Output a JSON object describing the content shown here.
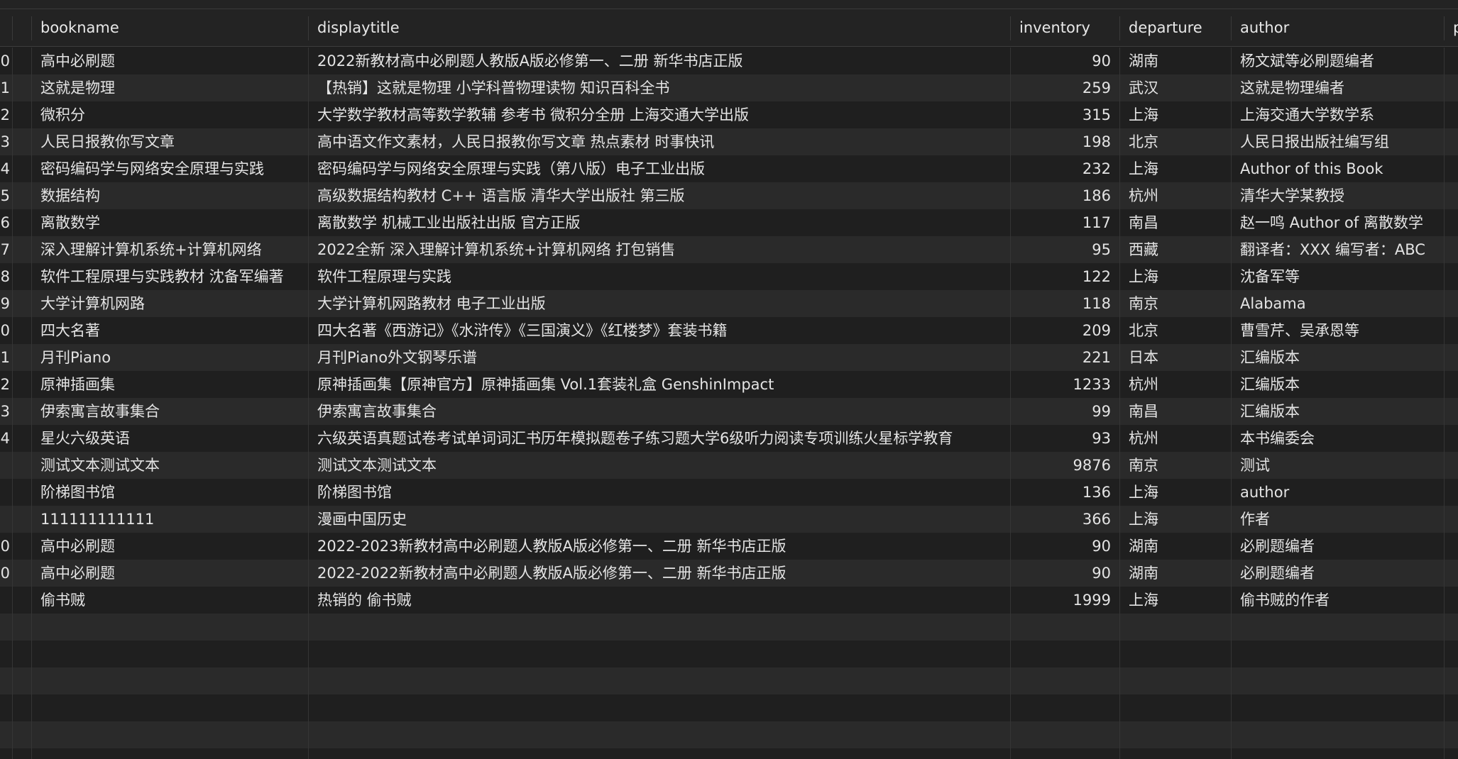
{
  "table": {
    "columns": [
      {
        "key": "index",
        "label": ""
      },
      {
        "key": "bookname",
        "label": "bookname"
      },
      {
        "key": "displaytitle",
        "label": "displaytitle"
      },
      {
        "key": "inventory",
        "label": "inventory"
      },
      {
        "key": "departure",
        "label": "departure"
      },
      {
        "key": "author",
        "label": "author"
      },
      {
        "key": "extra",
        "label": "p"
      }
    ],
    "rows": [
      {
        "index": "0",
        "bookname": "高中必刷题",
        "displaytitle": "2022新教材高中必刷题人教版A版必修第一、二册 新华书店正版",
        "inventory": "90",
        "departure": "湖南",
        "author": "杨文斌等必刷题编者"
      },
      {
        "index": "1",
        "bookname": "这就是物理",
        "displaytitle": "【热销】这就是物理 小学科普物理读物 知识百科全书",
        "inventory": "259",
        "departure": "武汉",
        "author": "这就是物理编者"
      },
      {
        "index": "2",
        "bookname": "微积分",
        "displaytitle": "大学数学教材高等数学教辅 参考书 微积分全册 上海交通大学出版",
        "inventory": "315",
        "departure": "上海",
        "author": "上海交通大学数学系"
      },
      {
        "index": "3",
        "bookname": "人民日报教你写文章",
        "displaytitle": "高中语文作文素材，人民日报教你写文章 热点素材 时事快讯",
        "inventory": "198",
        "departure": "北京",
        "author": "人民日报出版社编写组"
      },
      {
        "index": "4",
        "bookname": "密码编码学与网络安全原理与实践",
        "displaytitle": "密码编码学与网络安全原理与实践（第八版）电子工业出版",
        "inventory": "232",
        "departure": "上海",
        "author": "Author of this Book"
      },
      {
        "index": "5",
        "bookname": "数据结构",
        "displaytitle": "高级数据结构教材 C++ 语言版 清华大学出版社 第三版",
        "inventory": "186",
        "departure": "杭州",
        "author": "清华大学某教授"
      },
      {
        "index": "6",
        "bookname": "离散数学",
        "displaytitle": "离散数学 机械工业出版社出版 官方正版",
        "inventory": "117",
        "departure": "南昌",
        "author": "赵一鸣 Author of 离散数学"
      },
      {
        "index": "7",
        "bookname": "深入理解计算机系统+计算机网络",
        "displaytitle": "2022全新 深入理解计算机系统+计算机网络 打包销售",
        "inventory": "95",
        "departure": "西藏",
        "author": "翻译者：XXX 编写者：ABC"
      },
      {
        "index": "8",
        "bookname": "软件工程原理与实践教材 沈备军编著",
        "displaytitle": "软件工程原理与实践",
        "inventory": "122",
        "departure": "上海",
        "author": "沈备军等"
      },
      {
        "index": "9",
        "bookname": "大学计算机网路",
        "displaytitle": "大学计算机网路教材 电子工业出版",
        "inventory": "118",
        "departure": "南京",
        "author": "Alabama"
      },
      {
        "index": "0",
        "bookname": "四大名著",
        "displaytitle": "四大名著《西游记》《水浒传》《三国演义》《红楼梦》套装书籍",
        "inventory": "209",
        "departure": "北京",
        "author": "曹雪芹、吴承恩等"
      },
      {
        "index": "1",
        "bookname": "月刊Piano",
        "displaytitle": "月刊Piano外文钢琴乐谱",
        "inventory": "221",
        "departure": "日本",
        "author": "汇编版本"
      },
      {
        "index": "2",
        "bookname": "原神插画集",
        "displaytitle": "原神插画集【原神官方】原神插画集 Vol.1套装礼盒 GenshinImpact",
        "inventory": "1233",
        "departure": "杭州",
        "author": "汇编版本"
      },
      {
        "index": "3",
        "bookname": "伊索寓言故事集合",
        "displaytitle": "伊索寓言故事集合",
        "inventory": "99",
        "departure": "南昌",
        "author": "汇编版本"
      },
      {
        "index": "4",
        "bookname": "星火六级英语",
        "displaytitle": "六级英语真题试卷考试单词词汇书历年模拟题卷子练习题大学6级听力阅读专项训练火星标学教育",
        "inventory": "93",
        "departure": "杭州",
        "author": "本书编委会"
      },
      {
        "index": "",
        "bookname": "测试文本测试文本",
        "displaytitle": "测试文本测试文本",
        "inventory": "9876",
        "departure": "南京",
        "author": "测试"
      },
      {
        "index": "",
        "bookname": "阶梯图书馆",
        "displaytitle": "阶梯图书馆",
        "inventory": "136",
        "departure": "上海",
        "author": "author"
      },
      {
        "index": "",
        "bookname": "111111111111",
        "displaytitle": "漫画中国历史",
        "inventory": "366",
        "departure": "上海",
        "author": "作者"
      },
      {
        "index": "0",
        "bookname": "高中必刷题",
        "displaytitle": "2022-2023新教材高中必刷题人教版A版必修第一、二册 新华书店正版",
        "inventory": "90",
        "departure": "湖南",
        "author": "必刷题编者"
      },
      {
        "index": "0",
        "bookname": "高中必刷题",
        "displaytitle": "2022-2022新教材高中必刷题人教版A版必修第一、二册 新华书店正版",
        "inventory": "90",
        "departure": "湖南",
        "author": "必刷题编者"
      },
      {
        "index": "",
        "bookname": "偷书贼",
        "displaytitle": "热销的 偷书贼",
        "inventory": "1999",
        "departure": "上海",
        "author": "偷书贼的作者"
      }
    ],
    "empty_rows": 6
  }
}
